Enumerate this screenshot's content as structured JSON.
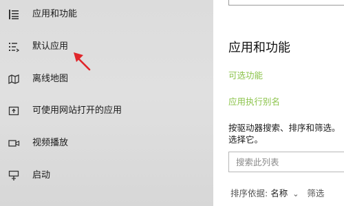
{
  "sidebar": {
    "items": [
      {
        "label": "应用和功能",
        "icon": "apps-list-icon"
      },
      {
        "label": "默认应用",
        "icon": "default-apps-icon"
      },
      {
        "label": "离线地图",
        "icon": "offline-maps-icon"
      },
      {
        "label": "可使用网站打开的应用",
        "icon": "apps-for-websites-icon"
      },
      {
        "label": "视频播放",
        "icon": "video-playback-icon"
      },
      {
        "label": "启动",
        "icon": "startup-icon"
      }
    ]
  },
  "main": {
    "section_title": "应用和功能",
    "links": {
      "optional_features": "可选功能",
      "app_aliases": "应用执行别名"
    },
    "description_line1": "按驱动器搜索、排序和筛选。",
    "description_line2": "选择它。",
    "search": {
      "placeholder": "搜索此列表",
      "value": ""
    },
    "sort": {
      "label": "排序依据:",
      "value": "名称",
      "filter_label": "筛选"
    }
  },
  "annotation": {
    "color": "#e0262b"
  },
  "colors": {
    "link": "#8bc34a",
    "sidebar_bg": "#dcdcdc"
  }
}
